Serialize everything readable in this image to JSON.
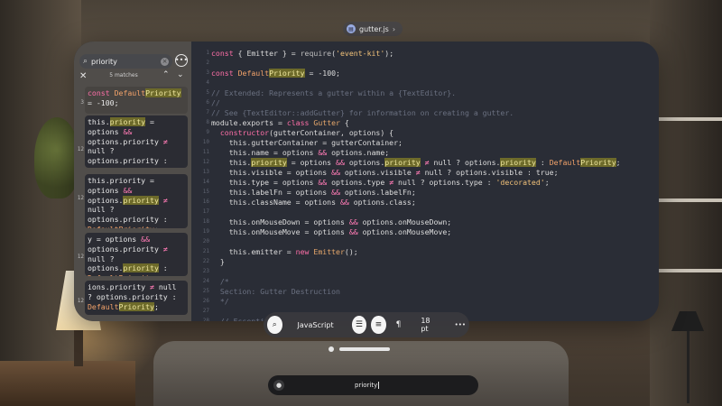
{
  "file": {
    "name": "gutter.js"
  },
  "search": {
    "query": "priority",
    "matches": "5 matches",
    "results": [
      {
        "line": "3"
      },
      {
        "line": "12"
      },
      {
        "line": "12"
      },
      {
        "line": "12"
      },
      {
        "line": "12"
      }
    ]
  },
  "code": {
    "line_numbers": [
      "1",
      "2",
      "3",
      "4",
      "5",
      "6",
      "7",
      "8",
      "9",
      "10",
      "11",
      "12",
      "13",
      "14",
      "15",
      "16",
      "17",
      "18",
      "19",
      "20",
      "21",
      "22",
      "23",
      "24",
      "25",
      "26",
      "27",
      "28"
    ]
  },
  "toolbar": {
    "language": "JavaScript",
    "font_size": "18 pt",
    "paragraph": "¶",
    "more": "•••"
  },
  "dictation": {
    "text": "priority"
  },
  "colors": {
    "window_bg": "#2a2d36",
    "keyword": "#ff6fa8",
    "string": "#f2c27a",
    "comment": "#6a7080",
    "highlight": "#6d6a2a"
  },
  "icons": [
    "search-icon",
    "clear-icon",
    "more-icon",
    "close-icon",
    "chevron-up-icon",
    "chevron-down-icon",
    "list-icon",
    "wrap-icon",
    "paragraph-icon",
    "mic-icon",
    "file-icon",
    "chevron-right-icon"
  ]
}
